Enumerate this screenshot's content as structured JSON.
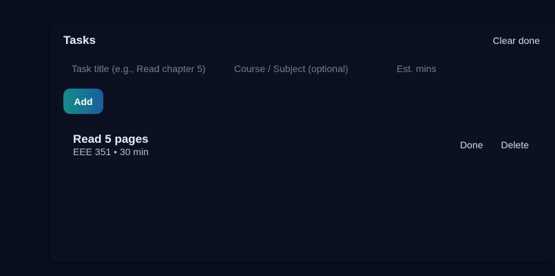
{
  "panel": {
    "title": "Tasks",
    "clear_label": "Clear done"
  },
  "form": {
    "title_placeholder": "Task title (e.g., Read chapter 5)",
    "course_placeholder": "Course / Subject (optional)",
    "mins_placeholder": "Est. mins",
    "add_label": "Add"
  },
  "tasks": [
    {
      "title": "Read 5 pages",
      "meta": "EEE 351 • 30 min",
      "done_label": "Done",
      "delete_label": "Delete"
    }
  ],
  "colors": {
    "background": "#0a0f1d",
    "panel": "#0b1020",
    "accent_start": "#138c8a",
    "accent_end": "#1b5e9e"
  }
}
